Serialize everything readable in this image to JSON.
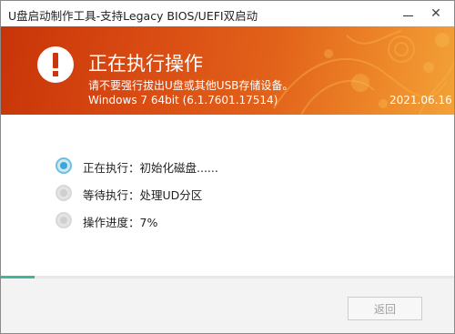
{
  "window": {
    "title": "U盘启动制作工具-支持Legacy BIOS/UEFI双启动",
    "minimize_symbol": "—",
    "close_symbol": "✕"
  },
  "banner": {
    "title": "正在执行操作",
    "warning": "请不要强行拔出U盘或其他USB存储设备。",
    "os_info": "Windows 7 64bit (6.1.7601.17514)",
    "date": "2021.06.16",
    "icon": "exclamation-icon",
    "colors": {
      "gradient_start": "#c83408",
      "gradient_end": "#f2a238"
    }
  },
  "steps": [
    {
      "text": "正在执行：初始化磁盘......",
      "state": "active"
    },
    {
      "text": "等待执行：处理UD分区",
      "state": "pending"
    },
    {
      "text": "操作进度：7%",
      "state": "pending"
    }
  ],
  "progress": {
    "fraction": 0.075,
    "color": "#3cb896"
  },
  "footer": {
    "back_label": "返回",
    "back_enabled": false
  }
}
